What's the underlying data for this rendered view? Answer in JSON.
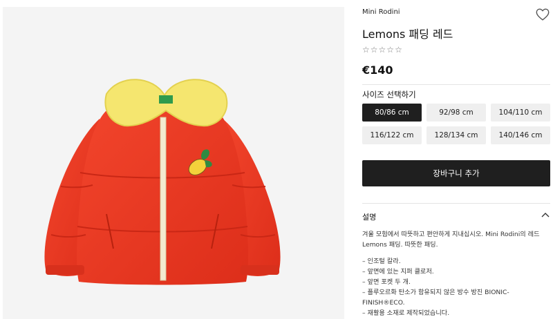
{
  "product": {
    "brand": "Mini Rodini",
    "title": "Lemons 패딩 레드",
    "rating_stars": [
      "☆",
      "☆",
      "☆",
      "☆",
      "☆"
    ],
    "price": "€140"
  },
  "size_selector": {
    "label": "사이즈 선택하기",
    "selected": "80/86 cm",
    "options": [
      "80/86 cm",
      "92/98 cm",
      "104/110 cm",
      "116/122 cm",
      "128/134 cm",
      "140/146 cm"
    ]
  },
  "cart": {
    "button_label": "장바구니 추가"
  },
  "description": {
    "heading": "설명",
    "intro_1": "겨울 모험에서 따뜻하고 편안하게 지내십시오. Mini Rodini의 레드",
    "intro_2": "Lemons 패딩. 따뜻한 패딩.",
    "bullets": [
      "– 인조털 칼라.",
      "– 앞면에 있는 지퍼 클로저.",
      "– 앞면 포켓 두 개.",
      "– 플루오르화 탄소가 함유되지 않은 방수 방진 BIONIC-",
      "FINISH®ECO.",
      "– 재활용 소재로 제작되었습니다."
    ]
  },
  "colors": {
    "jacket": "#ee3a24",
    "collar": "#f5e66f",
    "dark_button": "#1f1f1f",
    "size_bg": "#efefef"
  },
  "icons": {
    "wishlist": "heart-outline-icon",
    "collapse": "chevron-up-icon"
  }
}
